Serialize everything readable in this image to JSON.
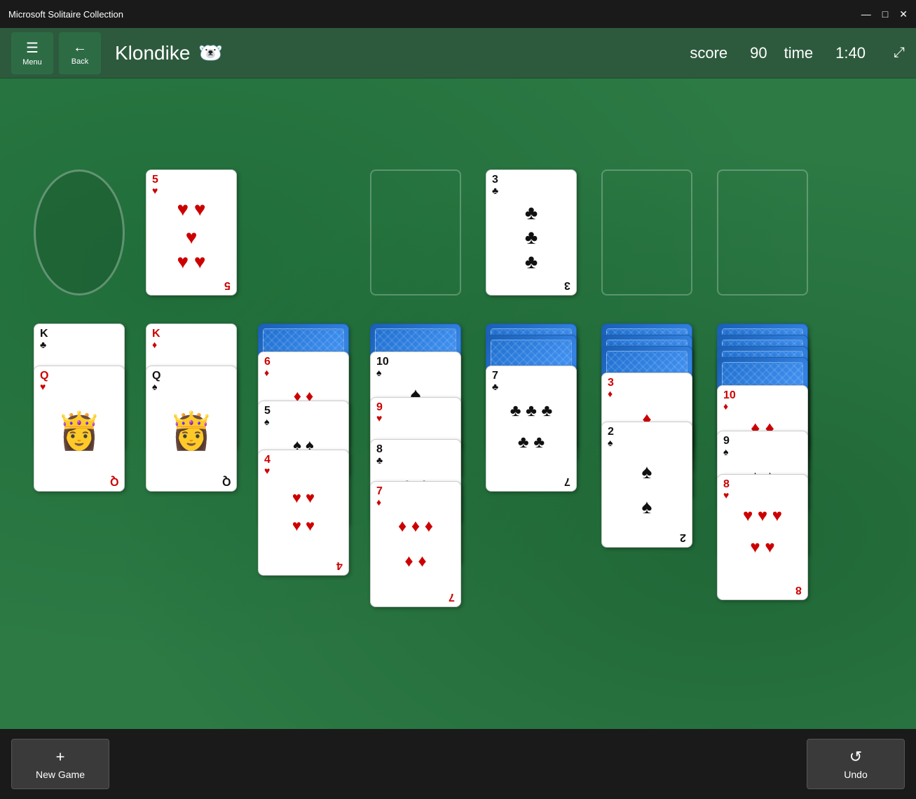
{
  "titlebar": {
    "title": "Microsoft Solitaire Collection",
    "minimize": "—",
    "maximize": "□",
    "close": "✕"
  },
  "toolbar": {
    "menu_label": "Menu",
    "back_label": "Back",
    "game_title": "Klondike",
    "score_label": "score",
    "score_value": "90",
    "time_label": "time",
    "time_value": "1:40"
  },
  "bottombar": {
    "new_game_label": "New Game",
    "new_game_icon": "+",
    "undo_label": "Undo",
    "undo_icon": "↺"
  },
  "game": {
    "stock_empty": true,
    "waste_card": {
      "rank": "5",
      "suit": "♥",
      "color": "red"
    },
    "foundations": [
      {
        "empty": true
      },
      {
        "rank": "3",
        "suit": "♣",
        "color": "black"
      },
      {
        "empty": true
      },
      {
        "empty": true
      }
    ],
    "tableau": [
      {
        "col": 1,
        "face_up": [
          {
            "rank": "K",
            "suit": "♣",
            "color": "black"
          },
          {
            "rank": "Q",
            "suit": "♥",
            "color": "red"
          }
        ],
        "face_down": 0
      },
      {
        "col": 2,
        "face_up": [
          {
            "rank": "K",
            "suit": "♦",
            "color": "red"
          },
          {
            "rank": "Q",
            "suit": "♠",
            "color": "black"
          }
        ],
        "face_down": 0
      },
      {
        "col": 3,
        "face_up": [
          {
            "rank": "6",
            "suit": "♦",
            "color": "red"
          },
          {
            "rank": "5",
            "suit": "♠",
            "color": "black"
          },
          {
            "rank": "4",
            "suit": "♥",
            "color": "red"
          }
        ],
        "face_down": 1
      },
      {
        "col": 4,
        "face_up": [
          {
            "rank": "10",
            "suit": "♠",
            "color": "black"
          },
          {
            "rank": "9",
            "suit": "♥",
            "color": "red"
          },
          {
            "rank": "8",
            "suit": "♣",
            "color": "black"
          },
          {
            "rank": "7",
            "suit": "♦",
            "color": "red"
          }
        ],
        "face_down": 1
      },
      {
        "col": 5,
        "face_up": [
          {
            "rank": "7",
            "suit": "♣",
            "color": "black"
          }
        ],
        "face_down": 2
      },
      {
        "col": 6,
        "face_up": [
          {
            "rank": "3",
            "suit": "♦",
            "color": "red"
          },
          {
            "rank": "2",
            "suit": "♠",
            "color": "black"
          }
        ],
        "face_down": 3
      },
      {
        "col": 7,
        "face_up": [
          {
            "rank": "10",
            "suit": "♦",
            "color": "red"
          },
          {
            "rank": "9",
            "suit": "♠",
            "color": "black"
          },
          {
            "rank": "8",
            "suit": "♥",
            "color": "red"
          }
        ],
        "face_down": 4
      }
    ]
  }
}
